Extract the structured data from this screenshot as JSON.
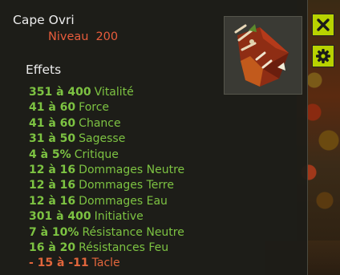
{
  "item": {
    "name": "Cape Ovri",
    "level_label": "Niveau",
    "level_value": "200"
  },
  "effects_title": "Effets",
  "effects": [
    {
      "value": "351 à 400",
      "name": "Vitalité",
      "sign": "positive"
    },
    {
      "value": "41 à 60",
      "name": "Force",
      "sign": "positive"
    },
    {
      "value": "41 à 60",
      "name": "Chance",
      "sign": "positive"
    },
    {
      "value": "31 à 50",
      "name": "Sagesse",
      "sign": "positive"
    },
    {
      "value": "4 à 5%",
      "name": "Critique",
      "sign": "positive"
    },
    {
      "value": "12 à 16",
      "name": "Dommages Neutre",
      "sign": "positive"
    },
    {
      "value": "12 à 16",
      "name": "Dommages Terre",
      "sign": "positive"
    },
    {
      "value": "12 à 16",
      "name": "Dommages Eau",
      "sign": "positive"
    },
    {
      "value": "301 à 400",
      "name": "Initiative",
      "sign": "positive"
    },
    {
      "value": "7 à 10%",
      "name": "Résistance Neutre",
      "sign": "positive"
    },
    {
      "value": "16 à 20",
      "name": "Résistances Feu",
      "sign": "positive"
    },
    {
      "value": "- 15 à -11",
      "name": "Tacle",
      "sign": "negative"
    }
  ],
  "colors": {
    "positive": "#7dc342",
    "negative": "#e2663c",
    "level": "#e85c3c",
    "button_accent": "#b8d200"
  },
  "icons": {
    "close": "close-icon",
    "settings": "gear-icon",
    "item": "cape-item-icon"
  }
}
